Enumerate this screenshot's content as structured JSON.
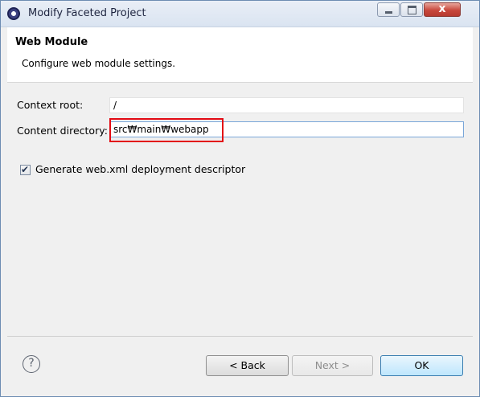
{
  "window": {
    "title": "Modify Faceted Project",
    "close_label": "x"
  },
  "header": {
    "title": "Web Module",
    "description": "Configure web module settings."
  },
  "form": {
    "context_root_label": "Context root:",
    "context_root_value": "/",
    "content_dir_label": "Content directory:",
    "content_dir_value": "src₩main₩webapp",
    "generate_label": "Generate web.xml deployment descriptor",
    "generate_checked": true
  },
  "footer": {
    "help_label": "?",
    "back_label": "< Back",
    "next_label": "Next >",
    "ok_label": "OK"
  },
  "icons": {
    "app": "eclipse-icon",
    "help": "help-icon",
    "check": "check-icon"
  },
  "colors": {
    "highlight": "#e30b14",
    "ok_button": "#bee6fd"
  }
}
